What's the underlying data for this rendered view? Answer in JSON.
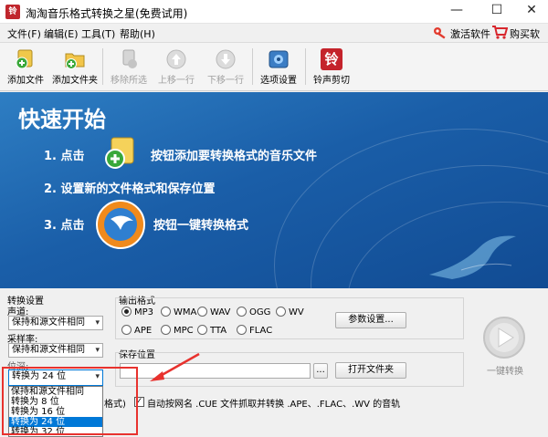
{
  "window": {
    "app_icon": "铃",
    "title": "淘淘音乐格式转换之星(免费试用)",
    "controls": [
      "—",
      "☐",
      "✕"
    ]
  },
  "menu": {
    "items": [
      "文件(F)",
      "编辑(E)",
      "工具(T)",
      "帮助(H)"
    ],
    "activate": "激活软件",
    "buy": "购买软件"
  },
  "toolbar": {
    "add_file": "添加文件",
    "add_folder": "添加文件夹",
    "remove": "移除所选",
    "move_up": "上移一行",
    "move_down": "下移一行",
    "options": "选项设置",
    "ringtone": "铃声剪切",
    "ringtone_glyph": "铃"
  },
  "banner": {
    "title": "快速开始",
    "step1_a": "1. 点击",
    "step1_b": "按钮添加要转换格式的音乐文件",
    "step2": "2. 设置新的文件格式和保存位置",
    "step3_a": "3. 点击",
    "step3_b": "按钮一键转换格式"
  },
  "settings": {
    "group_title": "转换设置",
    "channel_label": "声道:",
    "channel_value": "保持和源文件相同",
    "samplerate_label": "采样率:",
    "samplerate_value": "保持和源文件相同",
    "bitdepth_label": "位深:",
    "bitdepth_value": "转换为 24 位",
    "bitdepth_options": [
      "保持和源文件相同",
      "转换为 8 位",
      "转换为 16 位",
      "转换为 24 位",
      "转换为 32 位"
    ],
    "bitdepth_selected_index": 3
  },
  "output": {
    "group_title": "输出格式",
    "formats": [
      "MP3",
      "WMA",
      "WAV",
      "OGG",
      "WV",
      "APE",
      "MPC",
      "TTA",
      "FLAC"
    ],
    "selected_format": "MP3",
    "params_button": "参数设置...",
    "save_label": "保存位置",
    "save_path": "",
    "browse_button": "...",
    "open_folder_button": "打开文件夹",
    "cue_partial": "格式)",
    "cue_checkbox_label": "自动按网名 .CUE 文件抓取并转换 .APE、.FLAC、.WV 的音轨",
    "cue_checked": true
  },
  "convert": {
    "label": "一键转换"
  },
  "colors": {
    "banner": "#1a5ea8",
    "selection": "#0078d7",
    "annotation": "#e8322e"
  }
}
